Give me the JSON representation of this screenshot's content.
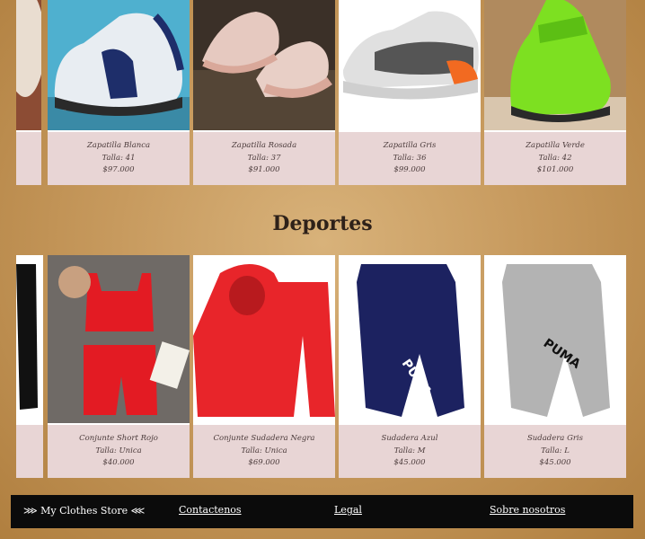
{
  "shoes": [
    {
      "name": "Zapatilla Blanca",
      "size": "Talla: 41",
      "price": "$97.000"
    },
    {
      "name": "Zapatilla Rosada",
      "size": "Talla: 37",
      "price": "$91.000"
    },
    {
      "name": "Zapatilla Gris",
      "size": "Talla: 36",
      "price": "$99.000"
    },
    {
      "name": "Zapatilla Verde",
      "size": "Talla: 42",
      "price": "$101.000"
    }
  ],
  "sports_title": "Deportes",
  "sports": [
    {
      "name": "Conjunte Short Rojo",
      "size": "Talla: Unica",
      "price": "$40.000"
    },
    {
      "name": "Conjunte Sudadera Negra",
      "size": "Talla: Unica",
      "price": "$69.000"
    },
    {
      "name": "Sudadera Azul",
      "size": "Talla: M",
      "price": "$45.000"
    },
    {
      "name": "Sudadera Gris",
      "size": "Talla: L",
      "price": "$45.000"
    }
  ],
  "footer": {
    "brand": "⋙ My Clothes Store ⋘",
    "links": [
      "Contactenos",
      "Legal",
      "Sobre nosotros"
    ]
  },
  "colors": {
    "info_bg": "#e8d5d5",
    "footer_bg": "#0b0b0b",
    "page_bg": "#c79a5e"
  }
}
